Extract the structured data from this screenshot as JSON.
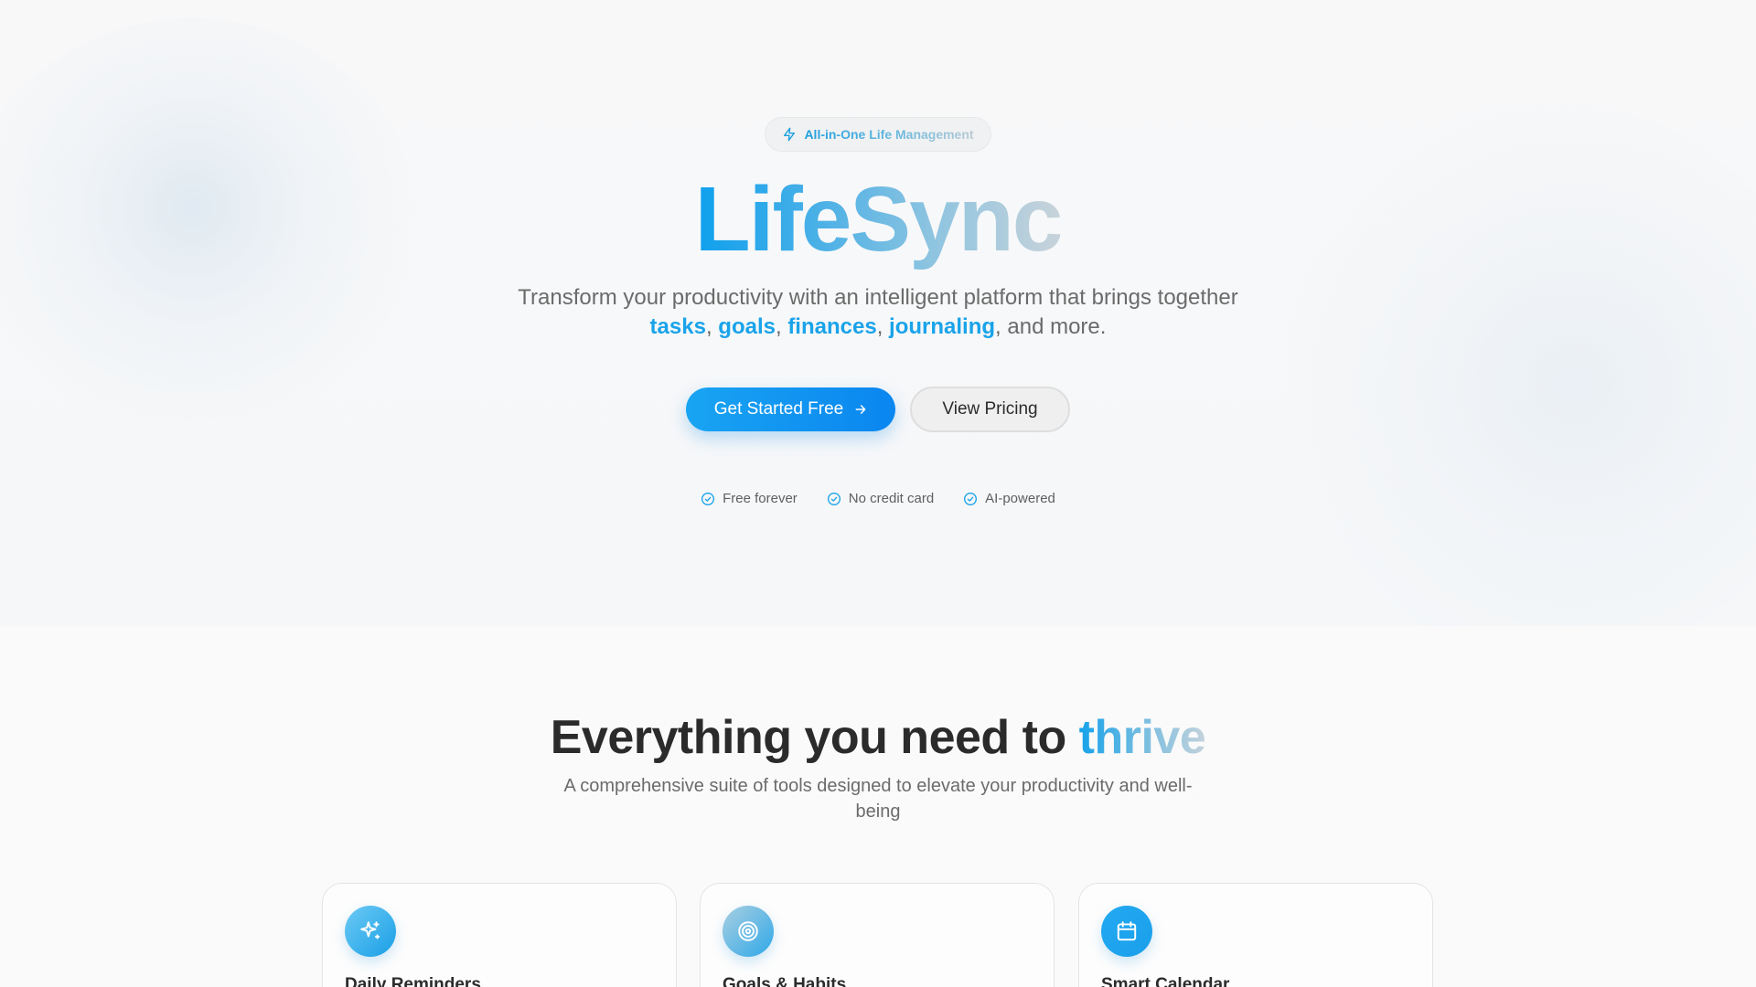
{
  "hero": {
    "badge": {
      "icon": "lightning-icon",
      "text": "All-in-One Life Management"
    },
    "brand": "LifeSync",
    "tagline": {
      "prefix": "Transform your productivity with an intelligent platform that brings together ",
      "highlights": [
        "tasks",
        "goals",
        "finances",
        "journaling"
      ],
      "separator": ", ",
      "suffix": ", and more."
    },
    "primary_button": {
      "label": "Get Started Free",
      "icon": "arrow-right-icon"
    },
    "secondary_button": {
      "label": "View Pricing"
    },
    "perks": [
      {
        "icon": "check-circle-icon",
        "label": "Free forever"
      },
      {
        "icon": "check-circle-icon",
        "label": "No credit card"
      },
      {
        "icon": "check-circle-icon",
        "label": "AI-powered"
      }
    ]
  },
  "features": {
    "title_prefix": "Everything you need to ",
    "title_accent": "thrive",
    "subtitle": "A comprehensive suite of tools designed to elevate your productivity and well-being",
    "cards": [
      {
        "icon": "sparkles-icon",
        "title": "Daily Reminders",
        "icon_colors": [
          "#5cc2f2",
          "#1a9fe6"
        ]
      },
      {
        "icon": "target-icon",
        "title": "Goals & Habits",
        "icon_colors": [
          "#9fc9de",
          "#2fa8e8"
        ]
      },
      {
        "icon": "calendar-icon",
        "title": "Smart Calendar",
        "icon_colors": [
          "#16a3ef",
          "#1aa0ea"
        ]
      }
    ]
  },
  "colors": {
    "accent": "#1aa3ea",
    "primary_button": "#0a86f0",
    "text_muted": "#6b6b6b",
    "text_dark": "#2b2b2b"
  }
}
